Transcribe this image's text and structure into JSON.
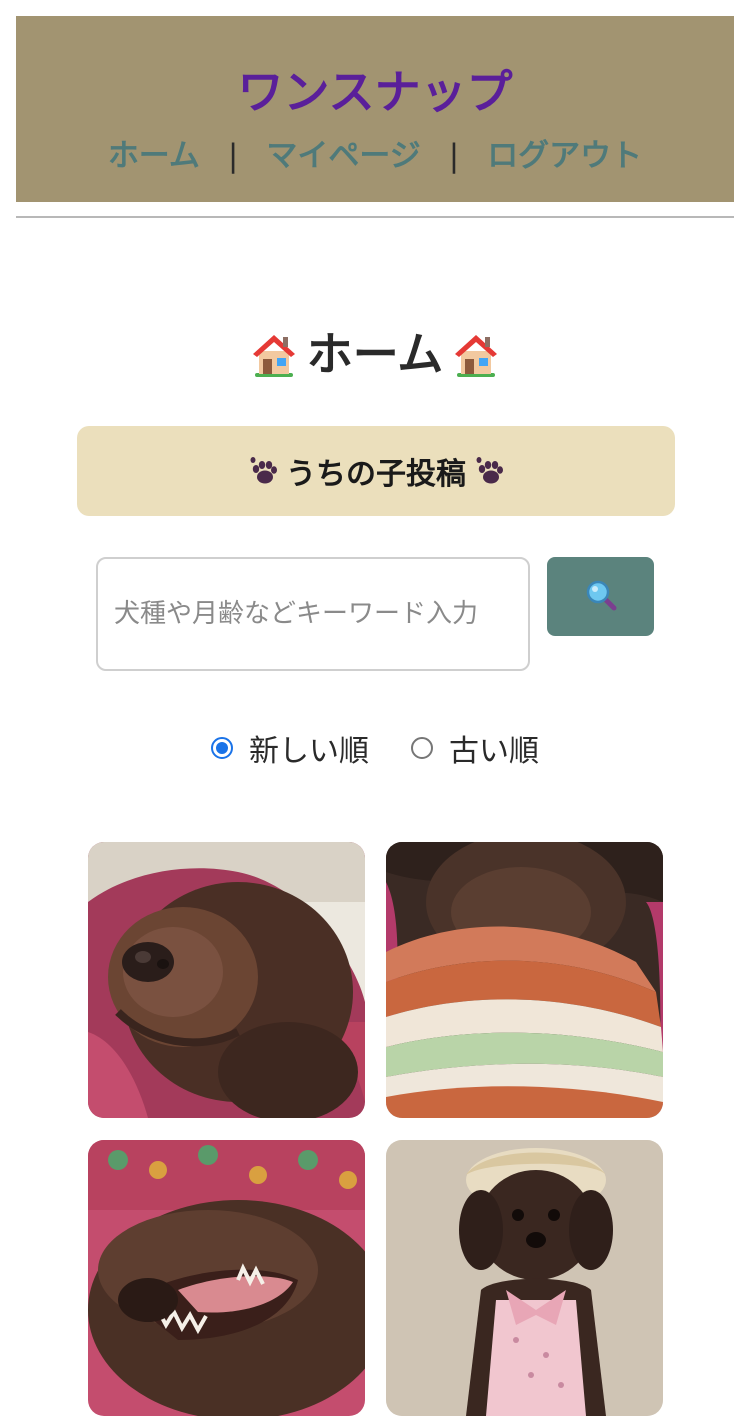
{
  "header": {
    "site_title": "ワンスナップ",
    "nav": {
      "home": "ホーム",
      "separator": "|",
      "mypage": "マイページ",
      "logout": "ログアウト"
    },
    "bg_color": "#a29471",
    "title_color": "#5a1f9a",
    "link_color": "#4f7a7a"
  },
  "main": {
    "page_title": "ホーム",
    "title_icon": "house-icon",
    "post_banner": {
      "label": "うちの子投稿",
      "icon": "paw-icon",
      "bg_color": "#ebdfbc"
    },
    "search": {
      "placeholder": "犬種や月齢などキーワード入力",
      "value": "",
      "button_icon": "magnifier-icon",
      "button_color": "#5b837d"
    },
    "sort": {
      "options": [
        {
          "label": "新しい順",
          "checked": true
        },
        {
          "label": "古い順",
          "checked": false
        }
      ]
    },
    "gallery": {
      "photos": [
        {
          "subject": "dog-closeup-nose"
        },
        {
          "subject": "dog-in-striped-sweater"
        },
        {
          "subject": "dog-yawning"
        },
        {
          "subject": "dog-with-bonnet"
        }
      ]
    }
  }
}
